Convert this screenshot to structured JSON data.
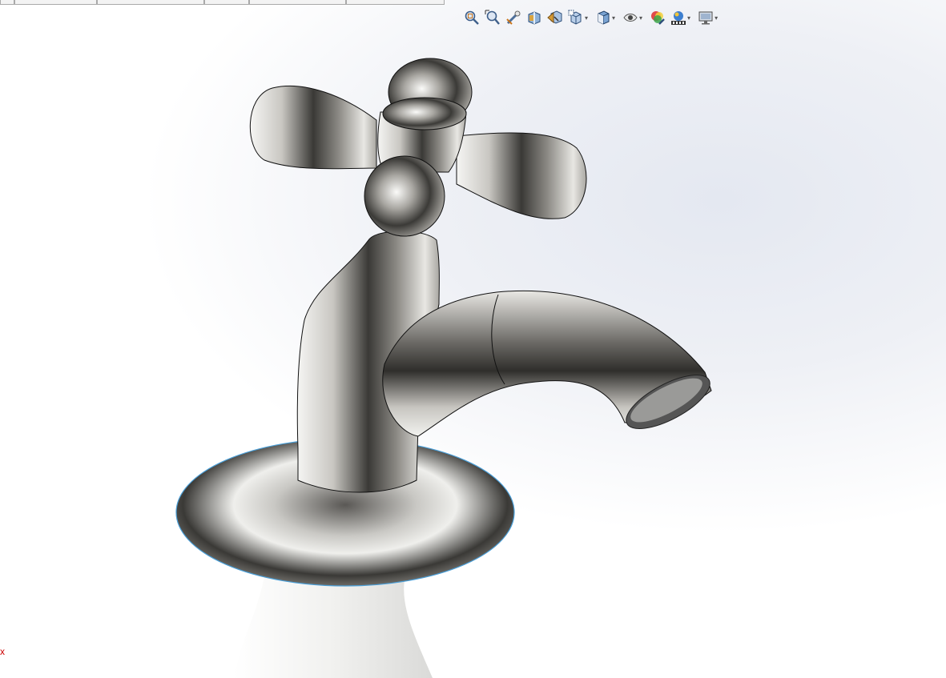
{
  "tabs": [
    "",
    "",
    "",
    "",
    "",
    ""
  ],
  "heads_up_toolbar": [
    {
      "icon": "zoom-to-fit-icon",
      "dropdown": false
    },
    {
      "icon": "zoom-to-area-icon",
      "dropdown": false
    },
    {
      "icon": "previous-view-icon",
      "dropdown": false
    },
    {
      "icon": "section-view-icon",
      "dropdown": false
    },
    {
      "icon": "dynamic-annotation-views-icon",
      "dropdown": false
    },
    {
      "icon": "view-orientation-icon",
      "dropdown": true
    },
    {
      "icon": "display-style-icon",
      "dropdown": true
    },
    {
      "icon": "hide-show-items-icon",
      "dropdown": true
    },
    {
      "icon": "edit-appearance-icon",
      "dropdown": false
    },
    {
      "icon": "apply-scene-icon",
      "dropdown": true
    },
    {
      "icon": "view-settings-icon",
      "dropdown": true
    }
  ],
  "triad": {
    "axis_label": "x",
    "color": "#cc0000"
  },
  "colors": {
    "accent_edge": "#4a9fd8",
    "metal_dark": "#2a2a2a",
    "metal_light": "#f4f4f2"
  }
}
